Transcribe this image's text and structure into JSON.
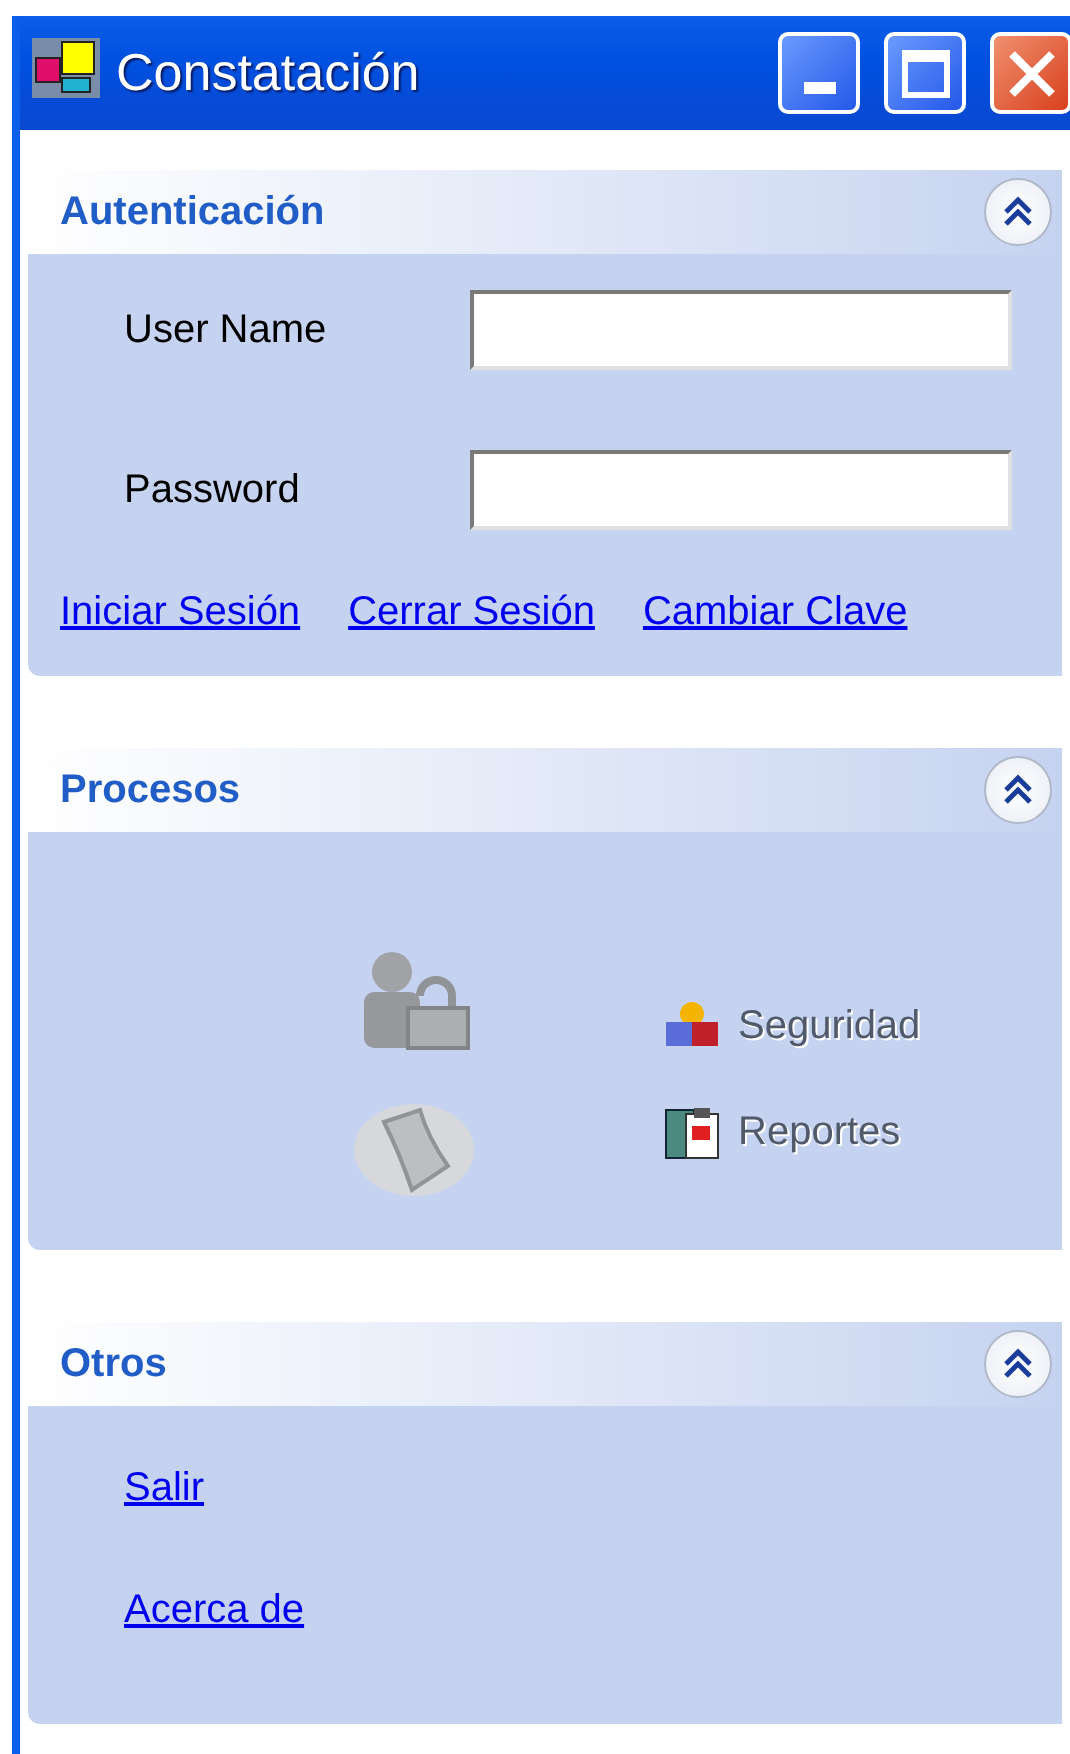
{
  "window": {
    "title": "Constatación"
  },
  "panels": [
    {
      "kind": "login",
      "title": "Autenticación",
      "expanded": true,
      "fields": [
        {
          "label": "User Name"
        },
        {
          "label": "Password"
        }
      ],
      "links": [
        "Iniciar Sesión",
        "Cerrar Sesión",
        "Cambiar Clave"
      ]
    },
    {
      "kind": "tasks",
      "title": "Procesos",
      "expanded": true,
      "items": [
        {
          "kind": "icon",
          "disabled": true
        },
        {
          "kind": "link",
          "label": "Seguridad"
        },
        {
          "kind": "icon",
          "disabled": true
        },
        {
          "kind": "link",
          "label": "Reportes"
        }
      ]
    },
    {
      "kind": "links",
      "title": "Otros",
      "expanded": true,
      "links": [
        "Salir",
        "Acerca de"
      ]
    }
  ]
}
